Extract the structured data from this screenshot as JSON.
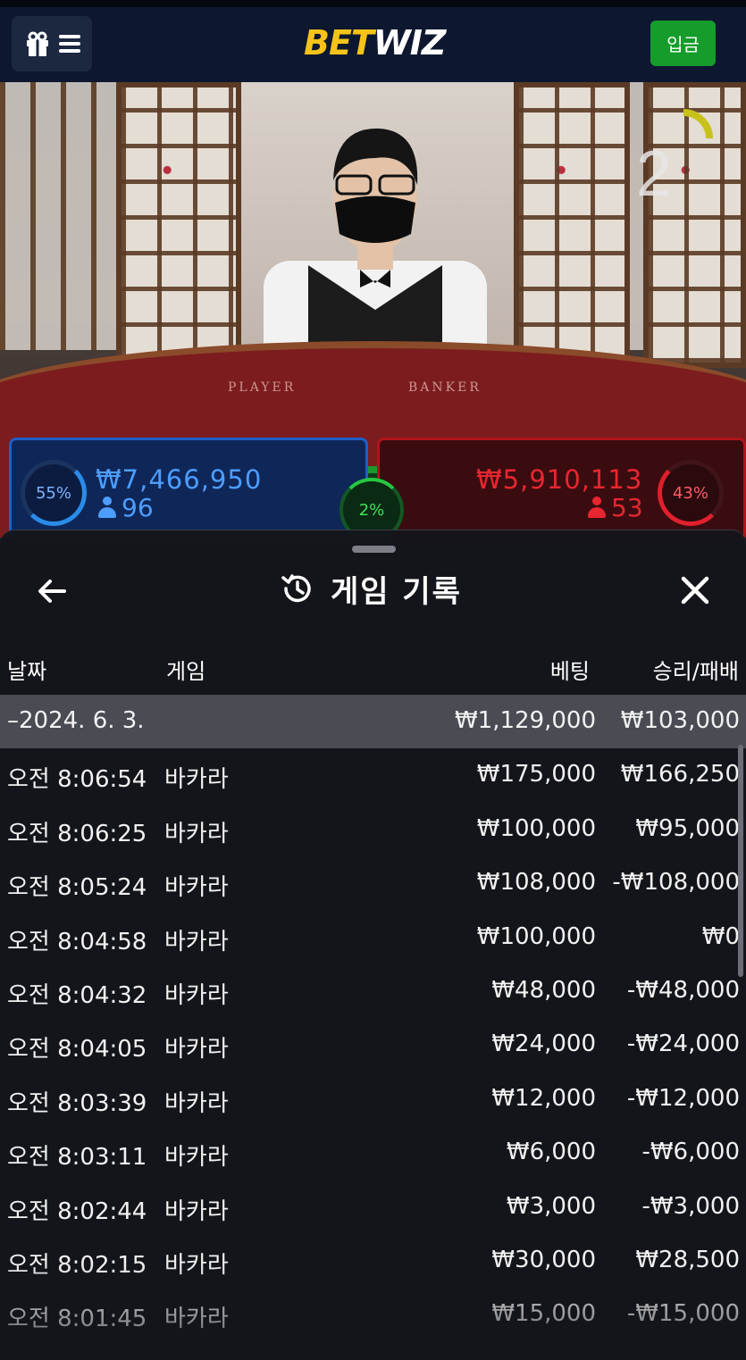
{
  "header": {
    "logo_part1": "BET",
    "logo_part2": "WIZ",
    "deposit_label": "입금",
    "icons": [
      "gift-icon",
      "hamburger-icon"
    ]
  },
  "video": {
    "countdown": "2",
    "player_label": "PLAYER",
    "banker_label": "BANKER"
  },
  "betting": {
    "player": {
      "percent": "55%",
      "amount": "₩7,466,950",
      "count": "96"
    },
    "tie": {
      "percent": "2%"
    },
    "banker": {
      "percent": "43%",
      "amount": "₩5,910,113",
      "count": "53"
    }
  },
  "sheet": {
    "title": "게임 기록",
    "icons": [
      "back-arrow-icon",
      "history-icon",
      "close-icon"
    ],
    "columns": {
      "date": "날짜",
      "game": "게임",
      "bet": "베팅",
      "win_loss": "승리/패배"
    },
    "summary": {
      "date": "–2024. 6. 3.",
      "game": "",
      "bet": "₩1,129,000",
      "win_loss": "₩103,000"
    },
    "rows": [
      {
        "time": "오전 8:06:54",
        "game": "바카라",
        "bet": "₩175,000",
        "win_loss": "₩166,250"
      },
      {
        "time": "오전 8:06:25",
        "game": "바카라",
        "bet": "₩100,000",
        "win_loss": "₩95,000"
      },
      {
        "time": "오전 8:05:24",
        "game": "바카라",
        "bet": "₩108,000",
        "win_loss": "-₩108,000"
      },
      {
        "time": "오전 8:04:58",
        "game": "바카라",
        "bet": "₩100,000",
        "win_loss": "₩0"
      },
      {
        "time": "오전 8:04:32",
        "game": "바카라",
        "bet": "₩48,000",
        "win_loss": "-₩48,000"
      },
      {
        "time": "오전 8:04:05",
        "game": "바카라",
        "bet": "₩24,000",
        "win_loss": "-₩24,000"
      },
      {
        "time": "오전 8:03:39",
        "game": "바카라",
        "bet": "₩12,000",
        "win_loss": "-₩12,000"
      },
      {
        "time": "오전 8:03:11",
        "game": "바카라",
        "bet": "₩6,000",
        "win_loss": "-₩6,000"
      },
      {
        "time": "오전 8:02:44",
        "game": "바카라",
        "bet": "₩3,000",
        "win_loss": "-₩3,000"
      },
      {
        "time": "오전 8:02:15",
        "game": "바카라",
        "bet": "₩30,000",
        "win_loss": "₩28,500"
      },
      {
        "time": "오전 8:01:45",
        "game": "바카라",
        "bet": "₩15,000",
        "win_loss": "-₩15,000"
      }
    ]
  },
  "colors": {
    "header_bg": "#0d1830",
    "logo_yellow": "#f6c318",
    "deposit_green": "#159c2b",
    "player_blue": "#1e60c8",
    "banker_red": "#b0151a",
    "tie_green": "#1c9a2e"
  }
}
